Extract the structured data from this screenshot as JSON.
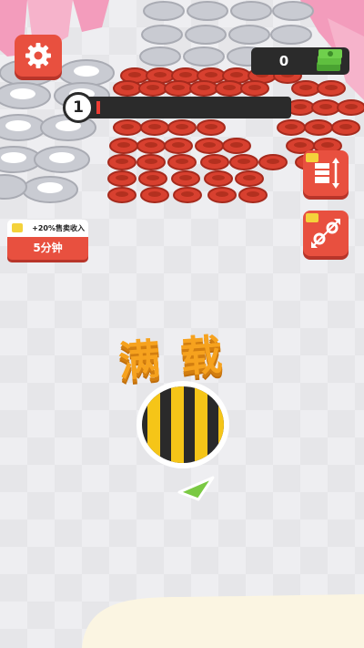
{
  "hud": {
    "money": "0",
    "level": "1",
    "level_progress": 0.02,
    "status_text": "满载",
    "bonus": {
      "title": "+20%售卖收入",
      "duration": "5分钟"
    }
  },
  "icons": {
    "settings": "gear-icon",
    "money": "cash-stack-icon",
    "capacity_upgrade": "capacity-upgrade-icon",
    "speed_upgrade": "speed-upgrade-icon",
    "ad_video": "video-ad-icon",
    "direction": "direction-arrow-icon"
  },
  "colors": {
    "accent_red": "#e8503f",
    "hud_dark": "#2b2b2b",
    "progress_red": "#ef3d34",
    "status_orange": "#f6a21e",
    "player_yellow": "#f5c518",
    "arrow_green": "#7ac943",
    "cash_green": "#5fbf3f"
  }
}
